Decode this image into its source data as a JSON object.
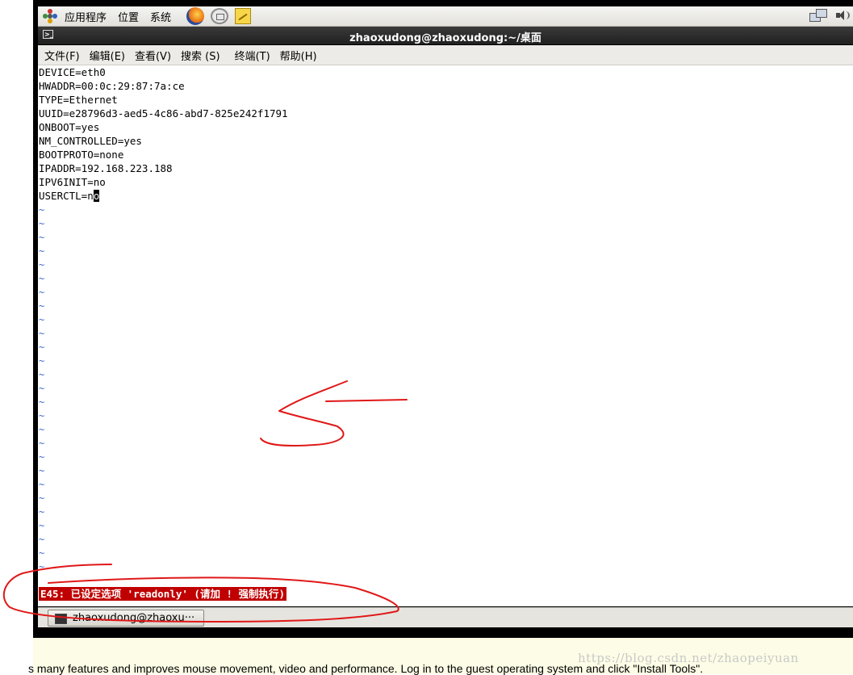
{
  "panel": {
    "menus": [
      "应用程序",
      "位置",
      "系统"
    ],
    "icons": [
      "gnome-foot-icon",
      "firefox-icon",
      "mail-icon",
      "note-icon",
      "network-icon",
      "volume-icon"
    ]
  },
  "window": {
    "title": "zhaoxudong@zhaoxudong:~/桌面"
  },
  "menubar": [
    "文件(F)",
    "编辑(E)",
    "查看(V)",
    "搜索 (S)",
    "终端(T)",
    "帮助(H)"
  ],
  "terminal": {
    "lines": [
      "DEVICE=eth0",
      "HWADDR=00:0c:29:87:7a:ce",
      "TYPE=Ethernet",
      "UUID=e28796d3-aed5-4c86-abd7-825e242f1791",
      "ONBOOT=yes",
      "NM_CONTROLLED=yes",
      "BOOTPROTO=none",
      "IPADDR=192.168.223.188",
      "IPV6INIT=no"
    ],
    "last_line_prefix": "USERCTL=n",
    "cursor_char": "o",
    "tilde": "~",
    "error": "E45: 已设定选项 'readonly' (请加 ! 强制执行)"
  },
  "taskbar": {
    "task_label": "zhaoxudong@zhaoxu···"
  },
  "hint": {
    "text": "s many features and improves mouse movement, video and performance. Log in to the guest operating system and click \"Install Tools\"."
  },
  "watermark": "https://blog.csdn.net/zhaopeiyuan",
  "colors": {
    "error_bg": "#c00000",
    "tilde": "#3a6ccf",
    "annotation": "#e01818"
  }
}
